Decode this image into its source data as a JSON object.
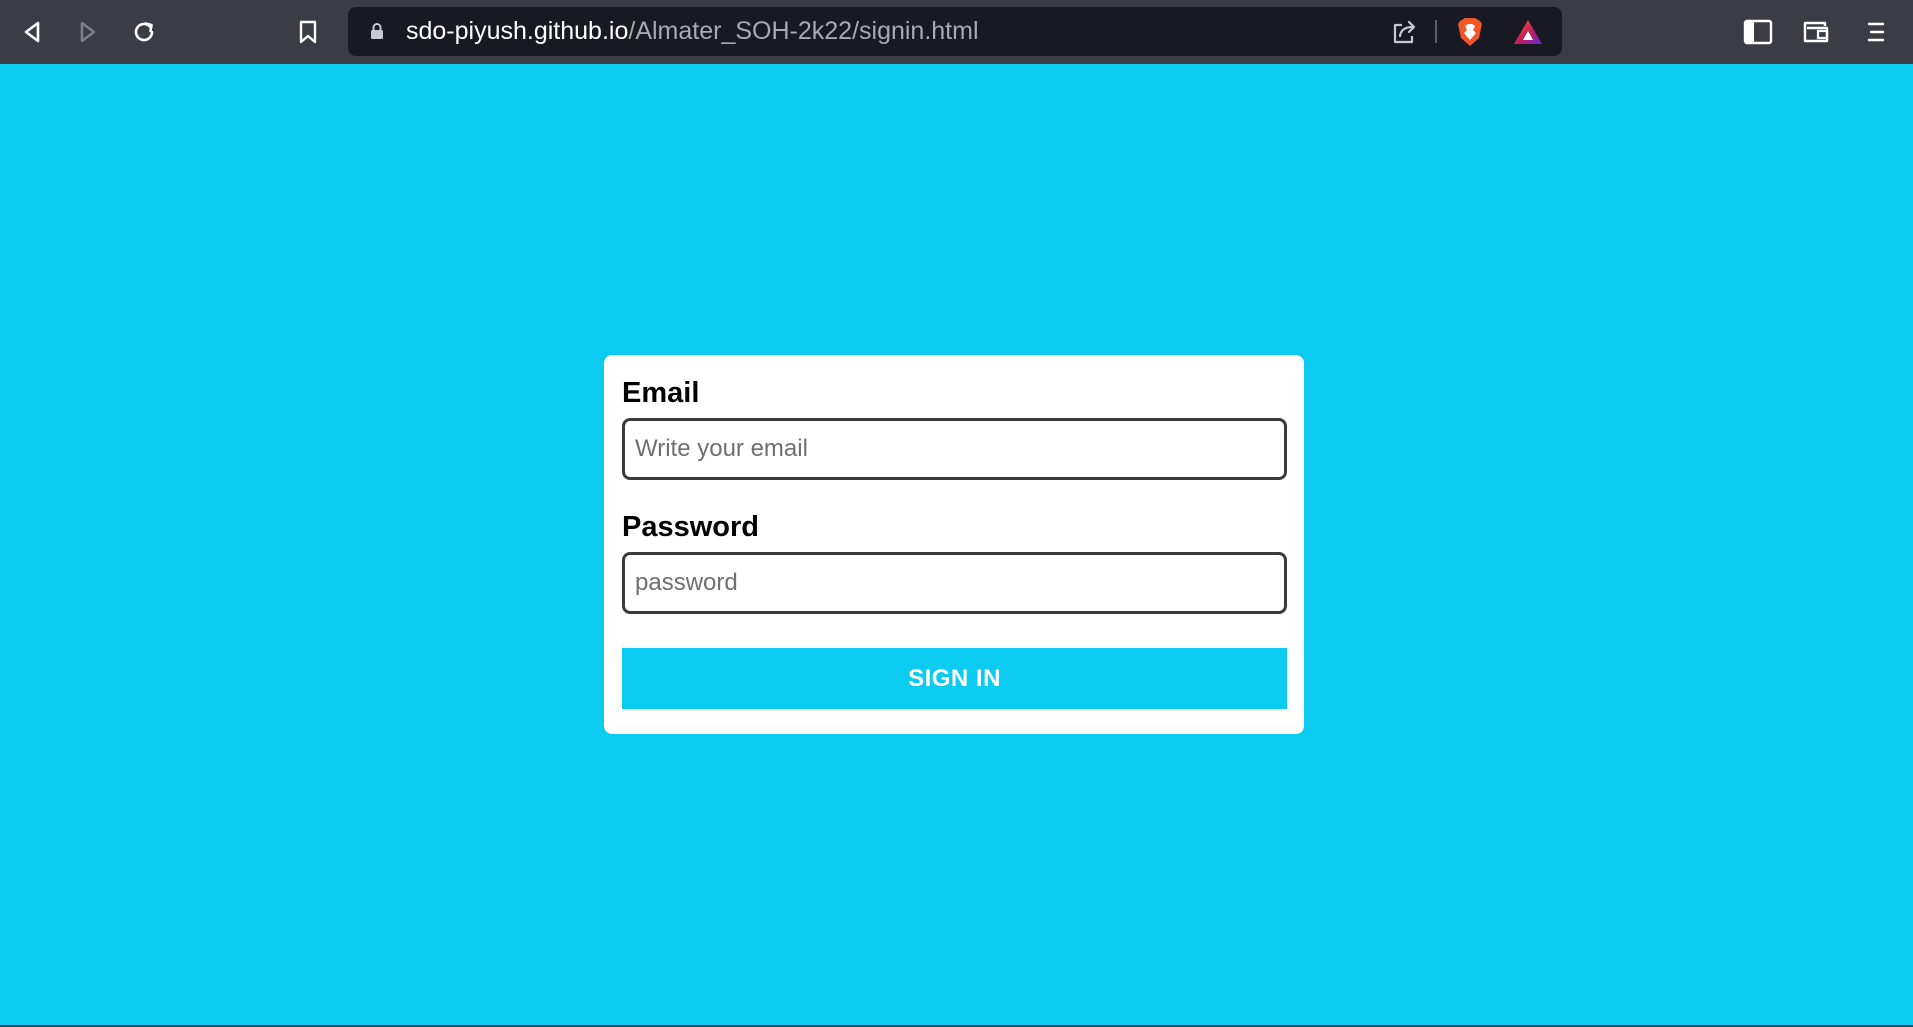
{
  "browser": {
    "url_host": "sdo-piyush.github.io",
    "url_path": "/Almater_SOH-2k22/signin.html",
    "icons": {
      "back": "back-arrow-icon",
      "forward": "forward-arrow-icon",
      "reload": "reload-icon",
      "bookmark": "bookmark-icon",
      "lock": "lock-icon",
      "share": "share-icon",
      "brave": "brave-shield-icon",
      "rewards": "brave-rewards-icon",
      "sidebar": "sidebar-icon",
      "wallet": "wallet-icon",
      "menu": "menu-icon"
    },
    "colors": {
      "toolbar": "#3b3c46",
      "urlbar": "#181922"
    }
  },
  "page": {
    "background": "#0ccbf0",
    "form": {
      "email_label": "Email",
      "email_placeholder": "Write your email",
      "email_value": "",
      "password_label": "Password",
      "password_placeholder": "password",
      "password_value": "",
      "submit_label": "SIGN IN",
      "accent": "#0ccbf0"
    }
  }
}
